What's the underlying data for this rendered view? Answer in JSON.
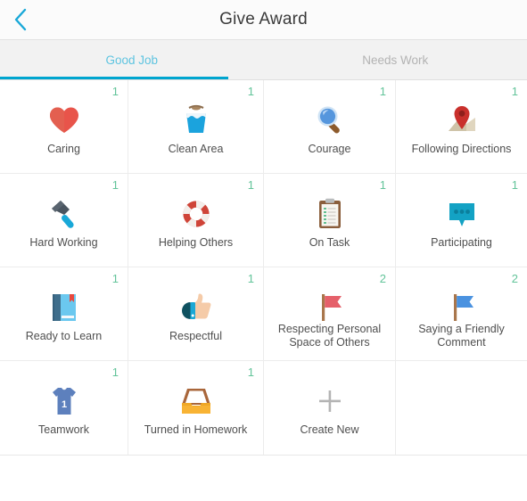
{
  "header": {
    "title": "Give Award",
    "back_icon": "chevron-left-icon",
    "back_color": "#19a8d8"
  },
  "tabs": {
    "active_index": 0,
    "active_color": "#00a5cf",
    "items": [
      {
        "label": "Good Job",
        "active": true
      },
      {
        "label": "Needs Work",
        "active": false
      }
    ]
  },
  "grid": {
    "count_color": "#63c49a",
    "columns": 4,
    "awards": [
      {
        "label": "Caring",
        "count": "1",
        "icon": "heart-icon",
        "lines": 1
      },
      {
        "label": "Clean Area",
        "count": "1",
        "icon": "bucket-icon",
        "lines": 1
      },
      {
        "label": "Courage",
        "count": "1",
        "icon": "magnifier-icon",
        "lines": 1
      },
      {
        "label": "Following Directions",
        "count": "1",
        "icon": "map-pin-icon",
        "lines": 1
      },
      {
        "label": "Hard Working",
        "count": "1",
        "icon": "hammer-icon",
        "lines": 1
      },
      {
        "label": "Helping Others",
        "count": "1",
        "icon": "life-ring-icon",
        "lines": 1
      },
      {
        "label": "On Task",
        "count": "1",
        "icon": "clipboard-icon",
        "lines": 1
      },
      {
        "label": "Participating",
        "count": "1",
        "icon": "speech-bubble-icon",
        "lines": 1
      },
      {
        "label": "Ready to Learn",
        "count": "1",
        "icon": "book-icon",
        "lines": 1
      },
      {
        "label": "Respectful",
        "count": "1",
        "icon": "thumbs-up-icon",
        "lines": 1
      },
      {
        "label": "Respecting Personal Space of Others",
        "count": "2",
        "icon": "red-flag-icon",
        "lines": 2
      },
      {
        "label": "Saying a Friendly Comment",
        "count": "2",
        "icon": "blue-flag-icon",
        "lines": 2
      },
      {
        "label": "Teamwork",
        "count": "1",
        "icon": "jersey-icon",
        "lines": 1
      },
      {
        "label": "Turned in Homework",
        "count": "1",
        "icon": "inbox-tray-icon",
        "lines": 1
      },
      {
        "label": "Create New",
        "count": "",
        "icon": "plus-icon",
        "lines": 1
      },
      {
        "label": "",
        "count": "",
        "icon": "",
        "lines": 1
      }
    ]
  }
}
